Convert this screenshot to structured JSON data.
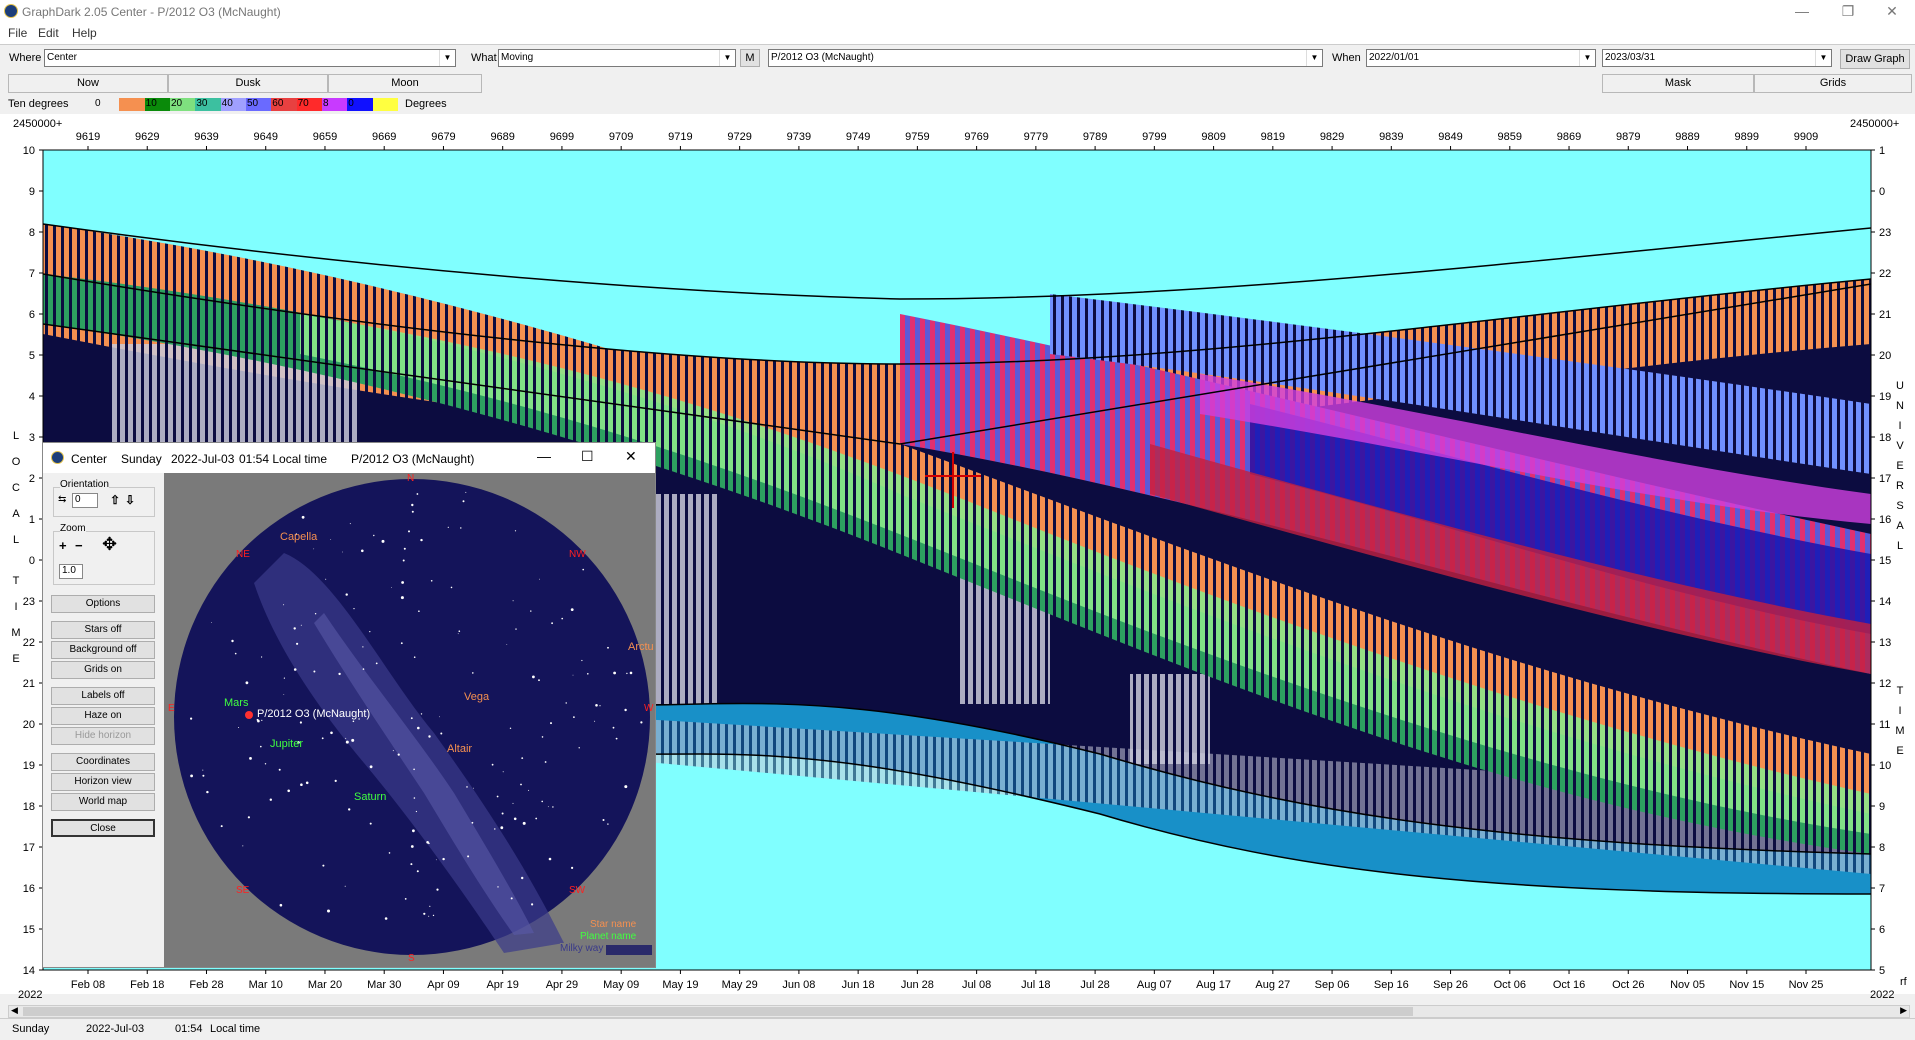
{
  "window": {
    "title": "GraphDark 2.05  Center  -  P/2012 O3 (McNaught)",
    "minimize": "—",
    "restore": "❐",
    "close": "✕"
  },
  "menu": [
    "File",
    "Edit",
    "Help"
  ],
  "toolbar": {
    "where_label": "Where",
    "where_value": "Center",
    "what_label": "What",
    "what_value": "Moving",
    "m_button": "M",
    "object_value": "P/2012 O3 (McNaught)",
    "when_label": "When",
    "start_date": "2022/01/01",
    "end_date": "2023/03/31",
    "draw_button": "Draw Graph"
  },
  "tabs": {
    "now": "Now",
    "dusk": "Dusk",
    "moon": "Moon",
    "mask": "Mask",
    "grids": "Grids"
  },
  "legend": {
    "label": "Ten degrees",
    "unit": "Degrees",
    "items": [
      {
        "text": "0",
        "color": "#f0f0f0"
      },
      {
        "text": "10",
        "color": "#0a8a0a"
      },
      {
        "text": "20",
        "color": "#7fe07f"
      },
      {
        "text": "30",
        "color": "#3cc0a0"
      },
      {
        "text": "40",
        "color": "#a0a0ff"
      },
      {
        "text": "50",
        "color": "#6a6aff"
      },
      {
        "text": "60",
        "color": "#e84040"
      },
      {
        "text": "70",
        "color": "#ff2a2a"
      },
      {
        "text": "8",
        "color": "#c83aff"
      },
      {
        "text": "0",
        "color": "#1010ff"
      },
      {
        "text": "",
        "color": "#ffff40"
      }
    ],
    "orange": "#f59050"
  },
  "plot": {
    "jd_prefix_left": "2450000+",
    "jd_prefix_right": "2450000+",
    "jd_ticks": [
      "9619",
      "9629",
      "9639",
      "9649",
      "9659",
      "9669",
      "9679",
      "9689",
      "9699",
      "9709",
      "9719",
      "9729",
      "9739",
      "9749",
      "9759",
      "9769",
      "9779",
      "9789",
      "9799",
      "9809",
      "9819",
      "9829",
      "9839",
      "9849",
      "9859",
      "9869",
      "9879",
      "9889",
      "9899",
      "9909"
    ],
    "date_ticks": [
      "Feb 08",
      "Feb 18",
      "Feb 28",
      "Mar 10",
      "Mar 20",
      "Mar 30",
      "Apr 09",
      "Apr 19",
      "Apr 29",
      "May 09",
      "May 19",
      "May 29",
      "Jun 08",
      "Jun 18",
      "Jun 28",
      "Jul 08",
      "Jul 18",
      "Jul 28",
      "Aug 07",
      "Aug 17",
      "Aug 27",
      "Sep 06",
      "Sep 16",
      "Sep 26",
      "Oct 06",
      "Oct 16",
      "Oct 26",
      "Nov 05",
      "Nov 15",
      "Nov 25"
    ],
    "year_left": "2022",
    "year_right": "2022",
    "left_ticks": [
      "10",
      "9",
      "8",
      "7",
      "6",
      "5",
      "4",
      "3",
      "2",
      "1",
      "0",
      "23",
      "22",
      "21",
      "20",
      "19",
      "18",
      "17",
      "16",
      "15",
      "14"
    ],
    "right_ticks": [
      "1",
      "0",
      "23",
      "22",
      "21",
      "20",
      "19",
      "18",
      "17",
      "16",
      "15",
      "14",
      "13",
      "12",
      "11",
      "10",
      "9",
      "8",
      "7",
      "6",
      "5"
    ],
    "left_axis_title": [
      "L",
      "O",
      "C",
      "A",
      "L",
      "",
      "T",
      "I",
      "M",
      "E"
    ],
    "right_axis_title": [
      "U",
      "N",
      "I",
      "V",
      "E",
      "R",
      "S",
      "A",
      "L",
      "",
      "T",
      "I",
      "M",
      "E"
    ],
    "right_corner": "rf",
    "colors": {
      "sky": "#80ffff",
      "night": "#0c0c40",
      "twilight": "#1890c8"
    }
  },
  "popup": {
    "title_where": "Center",
    "title_day": "Sunday",
    "title_date": "2022-Jul-03",
    "title_time": "01:54 Local time",
    "title_object": "P/2012 O3 (McNaught)",
    "orientation_label": "Orientation",
    "orientation_value": "0",
    "zoom_label": "Zoom",
    "zoom_value": "1.0",
    "buttons": {
      "options": "Options",
      "stars": "Stars off",
      "background": "Background off",
      "grids": "Grids on",
      "labels": "Labels off",
      "haze": "Haze on",
      "hide_horizon": "Hide horizon",
      "coordinates": "Coordinates",
      "horizon_view": "Horizon view",
      "world_map": "World map",
      "close": "Close"
    },
    "compass": {
      "n": "N",
      "ne": "NE",
      "nw": "NW",
      "e": "E",
      "w": "W",
      "se": "SE",
      "sw": "SW",
      "s": "S"
    },
    "objects": {
      "capella": "Capella",
      "vega": "Vega",
      "arcturus": "Arctu",
      "mars": "Mars",
      "comet": "P/2012 O3 (McNaught)",
      "jupiter": "Jupiter",
      "altair": "Altair",
      "saturn": "Saturn"
    },
    "legend": {
      "star": "Star name",
      "planet": "Planet name",
      "milky": "Milky way"
    }
  },
  "status": {
    "day": "Sunday",
    "date": "2022-Jul-03",
    "time": "01:54",
    "time_label": "Local time"
  }
}
